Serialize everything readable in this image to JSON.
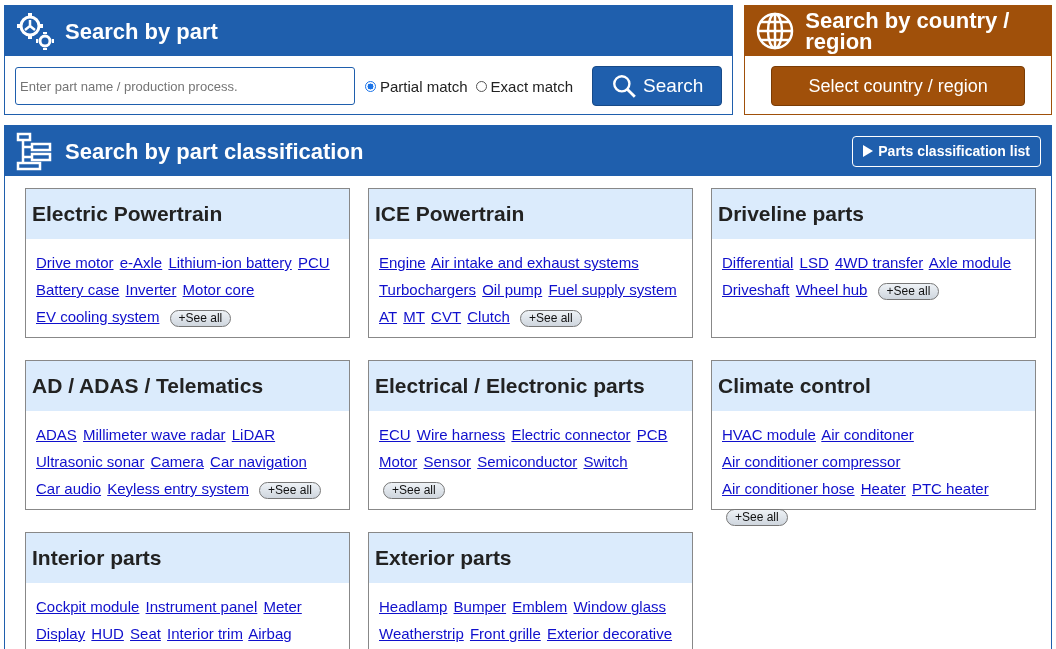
{
  "part_search": {
    "title": "Search by part",
    "placeholder": "Enter part name / production process.",
    "match_options": [
      {
        "label": "Partial match",
        "selected": true
      },
      {
        "label": "Exact match",
        "selected": false
      }
    ],
    "button": "Search"
  },
  "country_search": {
    "title": "Search by country / region",
    "button": "Select country / region"
  },
  "classification": {
    "title": "Search by part classification",
    "list_button": "Parts classification list",
    "categories": [
      {
        "title": "Electric Powertrain",
        "links": [
          "Drive motor",
          "e-Axle",
          "Lithium-ion battery",
          "PCU",
          "Battery case",
          "Inverter",
          "Motor core",
          "EV cooling system"
        ],
        "see_all": "+See all"
      },
      {
        "title": "ICE Powertrain",
        "links": [
          "Engine",
          "Air intake and exhaust systems",
          "Turbochargers",
          "Oil pump",
          "Fuel supply system",
          "AT",
          "MT",
          "CVT",
          "Clutch"
        ],
        "see_all": "+See all"
      },
      {
        "title": "Driveline parts",
        "links": [
          "Differential",
          "LSD",
          "4WD transfer",
          "Axle module",
          "Driveshaft",
          "Wheel hub"
        ],
        "see_all": "+See all"
      },
      {
        "title": "AD / ADAS / Telematics",
        "links": [
          "ADAS",
          "Millimeter wave radar",
          "LiDAR",
          "Ultrasonic sonar",
          "Camera",
          "Car navigation",
          "Car audio",
          "Keyless entry system"
        ],
        "see_all": "+See all"
      },
      {
        "title": "Electrical / Electronic parts",
        "links": [
          "ECU",
          "Wire harness",
          "Electric connector",
          "PCB",
          "Motor",
          "Sensor",
          "Semiconductor",
          "Switch"
        ],
        "see_all": "+See all"
      },
      {
        "title": "Climate control",
        "links": [
          "HVAC module",
          "Air conditoner",
          "Air conditioner compressor",
          "Air conditioner hose",
          "Heater",
          "PTC heater"
        ],
        "see_all": "+See all"
      },
      {
        "title": "Interior parts",
        "links": [
          "Cockpit module",
          "Instrument panel",
          "Meter",
          "Display",
          "HUD",
          "Seat",
          "Interior trim",
          "Airbag"
        ]
      },
      {
        "title": "Exterior parts",
        "links": [
          "Headlamp",
          "Bumper",
          "Emblem",
          "Window glass",
          "Weatherstrip",
          "Front grille",
          "Exterior decorative"
        ]
      }
    ]
  }
}
